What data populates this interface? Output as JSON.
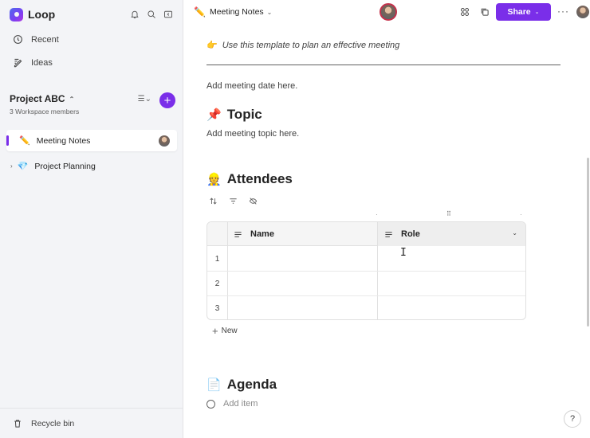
{
  "app": {
    "name": "Loop"
  },
  "sidebar": {
    "nav": [
      {
        "label": "Recent",
        "icon": "clock-icon"
      },
      {
        "label": "Ideas",
        "icon": "ideas-icon"
      }
    ],
    "project": {
      "name": "Project ABC",
      "members": "3 Workspace members"
    },
    "pages": [
      {
        "label": "Meeting Notes",
        "emoji": "✏️",
        "active": true
      },
      {
        "label": "Project Planning",
        "emoji": "💎",
        "active": false
      }
    ],
    "footer": {
      "label": "Recycle bin"
    }
  },
  "header": {
    "title": "Meeting Notes",
    "share_label": "Share",
    "more": "···"
  },
  "doc": {
    "tip_emoji": "👉",
    "tip": "Use this template to plan an effective meeting",
    "date_placeholder": "Add meeting date here.",
    "topic": {
      "emoji": "📌",
      "heading": "Topic",
      "placeholder": "Add meeting topic here."
    },
    "attendees": {
      "emoji": "👷",
      "heading": "Attendees",
      "columns": [
        "Name",
        "Role"
      ],
      "rows": [
        "1",
        "2",
        "3"
      ],
      "new_label": "New"
    },
    "agenda": {
      "emoji": "📄",
      "heading": "Agenda",
      "placeholder": "Add item"
    }
  },
  "help": "?",
  "colors": {
    "accent": "#7a2ee9"
  }
}
